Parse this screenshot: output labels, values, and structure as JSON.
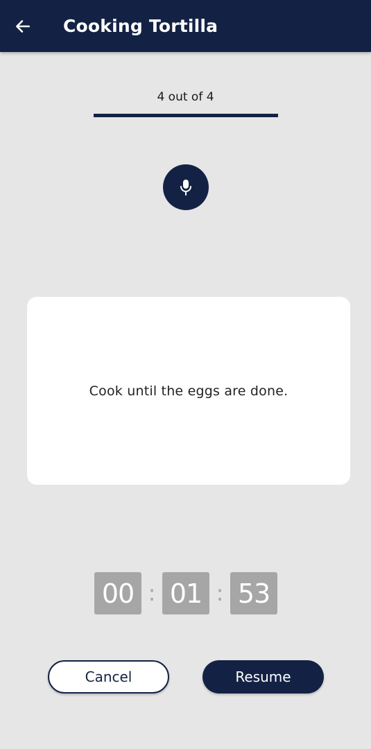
{
  "header": {
    "title": "Cooking Tortilla",
    "back_icon": "arrow-left-icon",
    "background": "#132244"
  },
  "progress": {
    "label": "4 out of 4",
    "current": 4,
    "total": 4,
    "fraction": 1.0
  },
  "voice": {
    "icon": "microphone-icon"
  },
  "step": {
    "instruction": "Cook until the eggs are done."
  },
  "timer": {
    "hours": "00",
    "minutes": "01",
    "seconds": "53",
    "separator": ":"
  },
  "actions": {
    "cancel_label": "Cancel",
    "resume_label": "Resume"
  },
  "colors": {
    "primary": "#132244",
    "background": "#e6e6e6",
    "timer_box": "#a6a6a6"
  }
}
